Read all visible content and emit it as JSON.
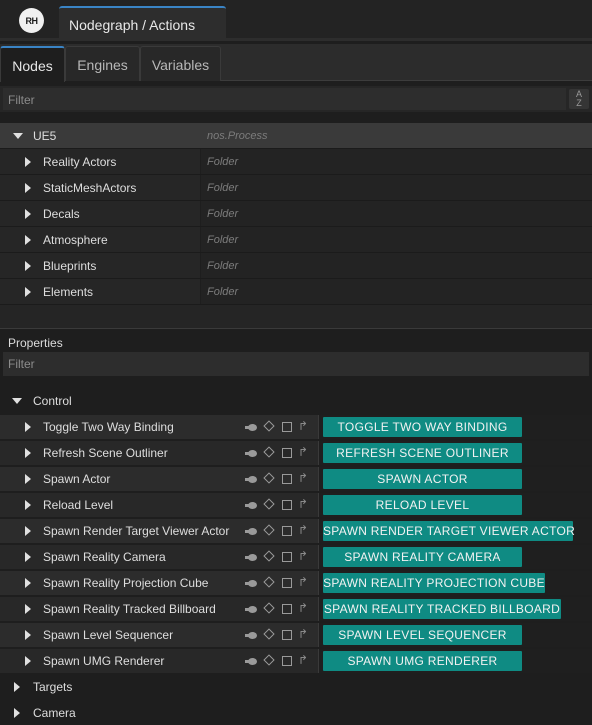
{
  "app": {
    "logo_text": "RH",
    "tab_title": "Nodegraph / Actions"
  },
  "subtabs": [
    {
      "label": "Nodes",
      "active": true
    },
    {
      "label": "Engines",
      "active": false
    },
    {
      "label": "Variables",
      "active": false
    }
  ],
  "nodes": {
    "filter_placeholder": "Filter",
    "sort_icon": "sort-az-icon",
    "root": {
      "label": "UE5",
      "value": "nos.Process",
      "expanded": true
    },
    "children": [
      {
        "label": "Reality Actors",
        "value": "Folder"
      },
      {
        "label": "StaticMeshActors",
        "value": "Folder"
      },
      {
        "label": "Decals",
        "value": "Folder"
      },
      {
        "label": "Atmosphere",
        "value": "Folder"
      },
      {
        "label": "Blueprints",
        "value": "Folder"
      },
      {
        "label": "Elements",
        "value": "Folder"
      }
    ]
  },
  "properties": {
    "title": "Properties",
    "filter_placeholder": "Filter",
    "control": {
      "label": "Control",
      "expanded": true,
      "items": [
        {
          "label": "Toggle Two Way Binding",
          "button": "TOGGLE TWO WAY BINDING"
        },
        {
          "label": "Refresh Scene Outliner",
          "button": "REFRESH SCENE OUTLINER"
        },
        {
          "label": "Spawn Actor",
          "button": "SPAWN ACTOR"
        },
        {
          "label": "Reload Level",
          "button": "RELOAD LEVEL"
        },
        {
          "label": "Spawn Render Target Viewer Actor",
          "button": "SPAWN RENDER TARGET VIEWER ACTOR"
        },
        {
          "label": "Spawn Reality Camera",
          "button": "SPAWN REALITY CAMERA"
        },
        {
          "label": "Spawn Reality Projection Cube",
          "button": "SPAWN REALITY PROJECTION CUBE"
        },
        {
          "label": "Spawn Reality Tracked Billboard",
          "button": "SPAWN REALITY TRACKED BILLBOARD"
        },
        {
          "label": "Spawn Level Sequencer",
          "button": "SPAWN LEVEL SEQUENCER"
        },
        {
          "label": "Spawn UMG Renderer",
          "button": "SPAWN UMG RENDERER"
        }
      ]
    },
    "collapsed_categories": [
      {
        "label": "Targets"
      },
      {
        "label": "Camera"
      }
    ]
  },
  "colors": {
    "accent": "#3a84c5",
    "action_button": "#0f8b83"
  }
}
